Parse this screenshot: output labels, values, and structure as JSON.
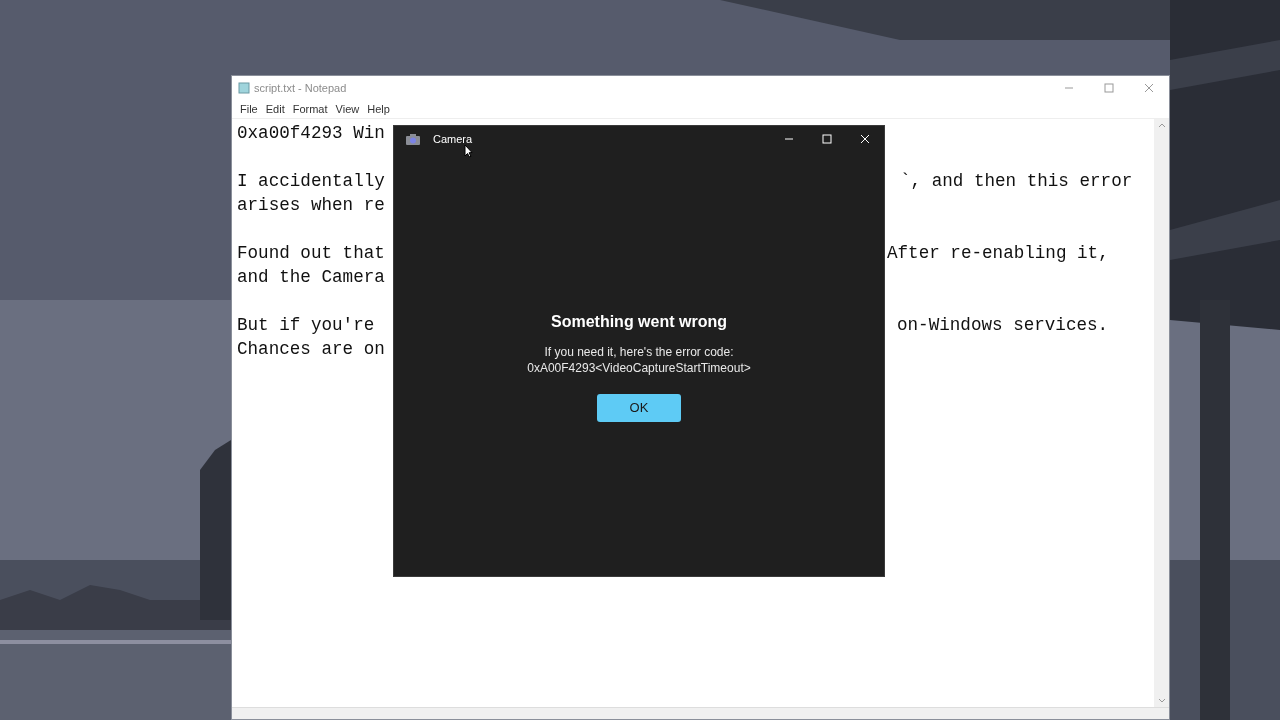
{
  "notepad": {
    "title": "script.txt - Notepad",
    "active": false,
    "menu": [
      "File",
      "Edit",
      "Format",
      "View",
      "Help"
    ],
    "lines": [
      {
        "kind": "text",
        "left": "0xa00f4293 Win"
      },
      {
        "kind": "blank"
      },
      {
        "kind": "text",
        "left": "I accidentally",
        "right": "`, and then this error"
      },
      {
        "kind": "text",
        "left": "arises when re"
      },
      {
        "kind": "blank"
      },
      {
        "kind": "text",
        "left": "Found out that",
        "right": "After re-enabling it,"
      },
      {
        "kind": "text",
        "left": "and the Camera"
      },
      {
        "kind": "blank"
      },
      {
        "kind": "text",
        "left": "But if you're",
        "right": "on-Windows services."
      },
      {
        "kind": "text",
        "left": "Chances are on"
      }
    ]
  },
  "camera": {
    "title": "Camera",
    "active": true,
    "heading": "Something went wrong",
    "message": "If you need it, here's the error code:",
    "code": "0xA00F4293<VideoCaptureStartTimeout>",
    "button": "OK"
  }
}
